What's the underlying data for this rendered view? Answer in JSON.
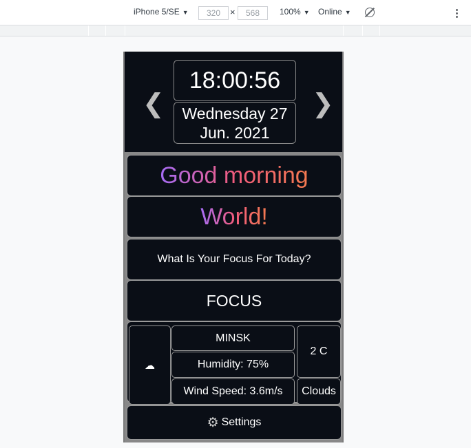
{
  "devtools": {
    "device": "iPhone 5/SE",
    "width": "320",
    "height": "568",
    "zoom": "100%",
    "network": "Online",
    "rotate_icon": "rotate-icon",
    "menu_icon": "kebab-menu-icon"
  },
  "app": {
    "time": "18:00:56",
    "date_line1": "Wednesday 27",
    "date_line2": "Jun. 2021",
    "prev_arrow": "❮",
    "next_arrow": "❯",
    "greeting": "Good morning",
    "name": "World!",
    "focus_prompt": "What Is Your Focus For Today?",
    "focus_value": "FOCUS",
    "weather": {
      "icon": "cloud-icon",
      "city": "MINSK",
      "temperature": "2 C",
      "humidity": "Humidity: 75%",
      "wind": "Wind Speed: 3.6m/s",
      "description": "Clouds"
    },
    "settings_label": "Settings",
    "settings_icon": "gear-icon"
  }
}
